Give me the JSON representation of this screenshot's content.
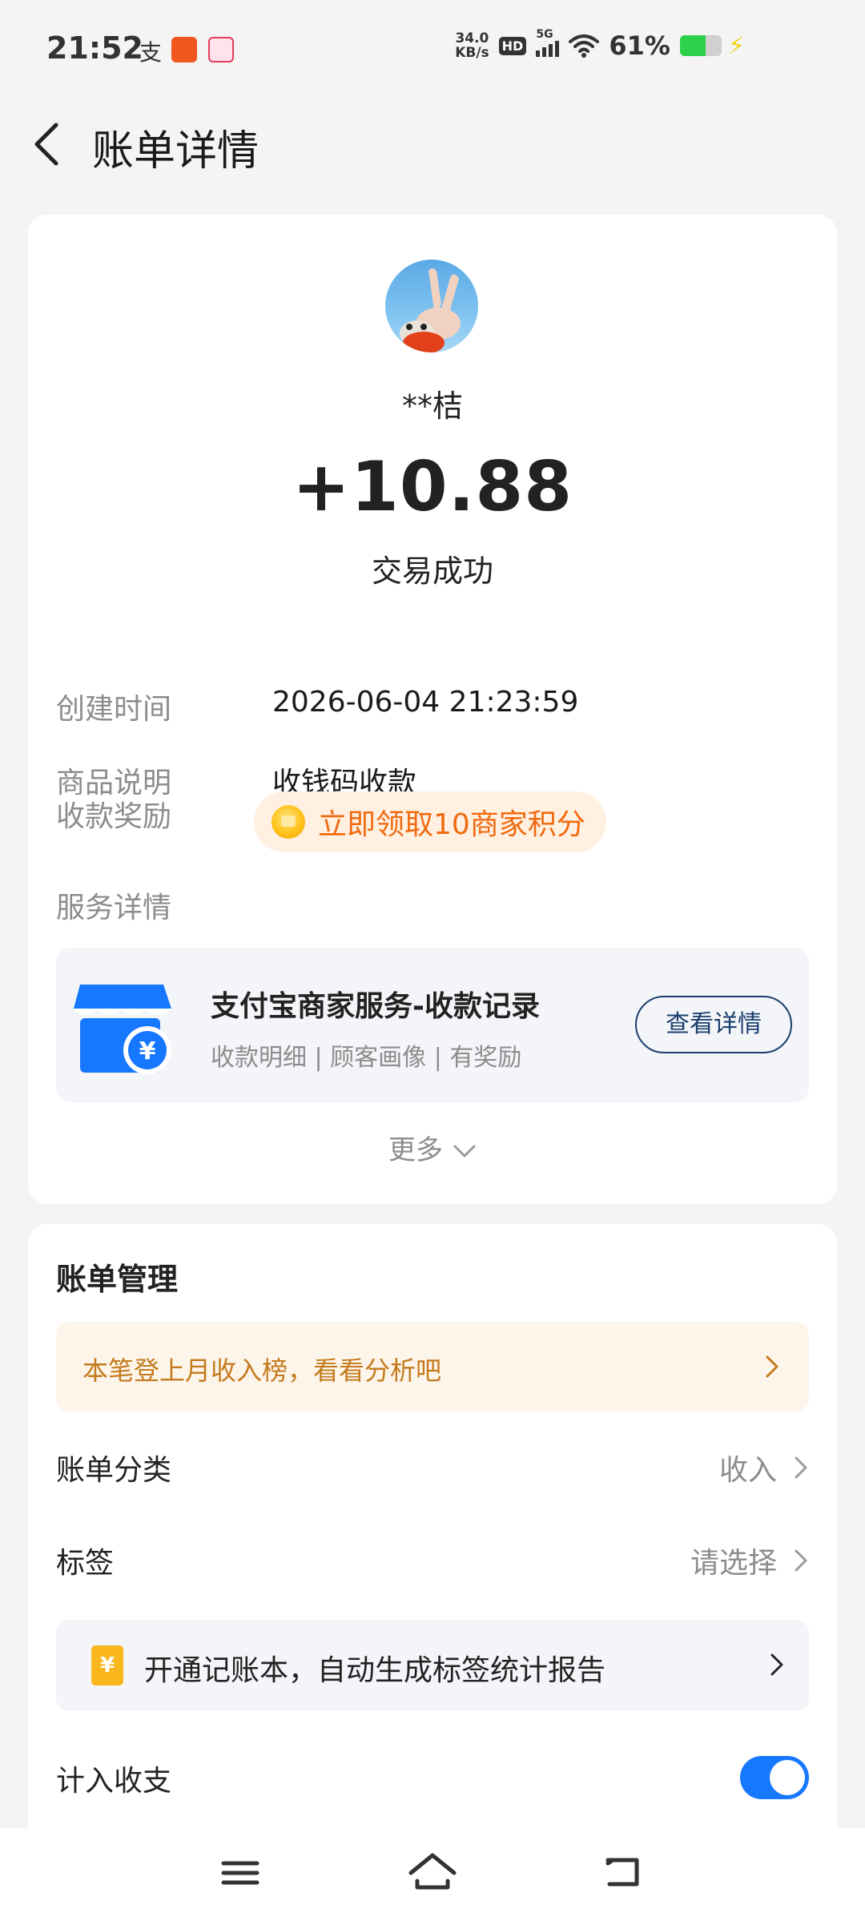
{
  "status_bar": {
    "time": "21:52",
    "alipay_glyph": "支",
    "speed_value": "34.0",
    "speed_unit": "KB/s",
    "hd": "HD",
    "network": "5G",
    "battery_text": "61%",
    "battery_level": 0.61,
    "icons": [
      "alipay-icon",
      "app-icon",
      "app-icon",
      "hd-icon",
      "signal-icon",
      "wifi-icon",
      "battery-icon",
      "charging-icon"
    ]
  },
  "header": {
    "title": "账单详情"
  },
  "transaction": {
    "payer": "**桔",
    "amount": "+10.88",
    "status": "交易成功"
  },
  "details": {
    "created_label": "创建时间",
    "created_value": "2026-06-04 21:23:59",
    "product_label": "商品说明",
    "product_value": "收钱码收款",
    "reward_label": "收款奖励",
    "reward_button": "立即领取10商家积分",
    "service_label": "服务详情"
  },
  "service": {
    "title": "支付宝商家服务-收款记录",
    "subtitle": "收款明细 | 顾客画像 | 有奖励",
    "button": "查看详情",
    "icon": "shop-yuan-icon"
  },
  "more": {
    "label": "更多"
  },
  "manage": {
    "title": "账单管理",
    "tip": "本笔登上月收入榜，看看分析吧",
    "category_label": "账单分类",
    "category_value": "收入",
    "tag_label": "标签",
    "tag_value": "请选择",
    "book_icon_glyph": "¥",
    "book_banner": "开通记账本，自动生成标签统计报告",
    "count_label": "计入收支",
    "count_enabled": true
  },
  "colors": {
    "accent_blue": "#1677ff",
    "reward_orange": "#f06a0f",
    "tip_brown": "#c47a1c",
    "button_navy": "#1a3f6d"
  }
}
